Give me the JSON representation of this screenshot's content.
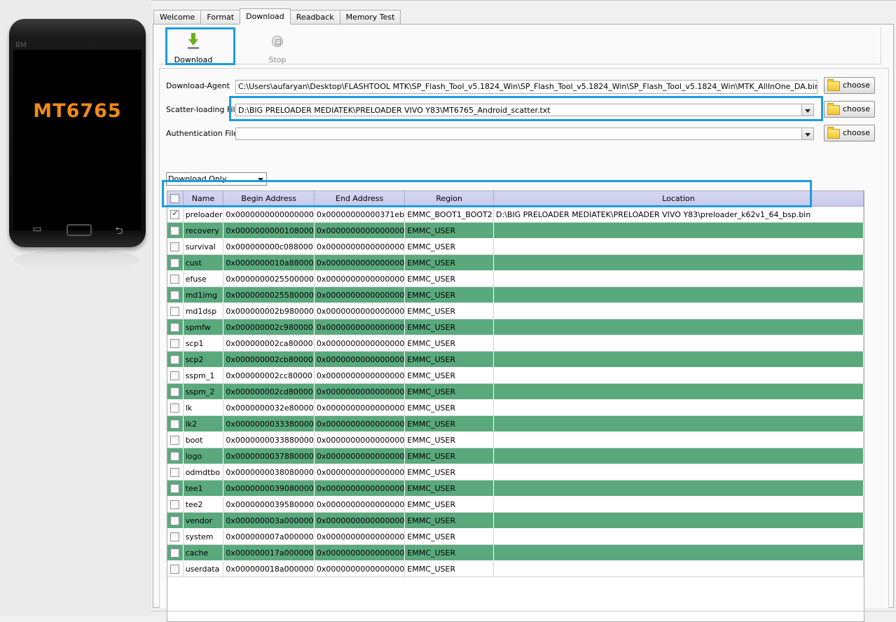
{
  "phone": {
    "brand": "BM",
    "model": "MT6765",
    "menu_key_glyph": "▭",
    "back_key_glyph": "⮌"
  },
  "tabs": [
    {
      "label": "Welcome",
      "active": false
    },
    {
      "label": "Format",
      "active": false
    },
    {
      "label": "Download",
      "active": true
    },
    {
      "label": "Readback",
      "active": false
    },
    {
      "label": "Memory Test",
      "active": false
    }
  ],
  "toolbar": {
    "download_label": "Download",
    "stop_label": "Stop",
    "download_icon": "green-down-arrow-icon",
    "stop_icon": "stop-icon"
  },
  "fields": {
    "download_agent_label": "Download-Agent",
    "download_agent_value": "C:\\Users\\aufaryan\\Desktop\\FLASHTOOL MTK\\SP_Flash_Tool_v5.1824_Win\\SP_Flash_Tool_v5.1824_Win\\SP_Flash_Tool_v5.1824_Win\\MTK_AllInOne_DA.bin",
    "scatter_label": "Scatter-loading File",
    "scatter_value": "D:\\BIG PRELOADER MEDIATEK\\PRELOADER VIVO Y83\\MT6765_Android_scatter.txt",
    "auth_label": "Authentication File",
    "auth_value": "",
    "choose_label": "choose",
    "mode_value": "Download Only"
  },
  "colors": {
    "highlight": "#1b9ce0",
    "row_alt": "#5aa97d",
    "header": "#d0d0f0",
    "accent_text": "#f08a18"
  },
  "table": {
    "columns": [
      "",
      "Name",
      "Begin Address",
      "End Address",
      "Region",
      "Location"
    ],
    "rows": [
      {
        "checked": true,
        "name": "preloader",
        "begin": "0x0000000000000000",
        "end": "0x00000000000371eb",
        "region": "EMMC_BOOT1_BOOT2",
        "location": "D:\\BIG PRELOADER MEDIATEK\\PRELOADER VIVO Y83\\preloader_k62v1_64_bsp.bin"
      },
      {
        "checked": false,
        "name": "recovery",
        "begin": "0x0000000000108000",
        "end": "0x0000000000000000",
        "region": "EMMC_USER",
        "location": ""
      },
      {
        "checked": false,
        "name": "survival",
        "begin": "0x000000000c088000",
        "end": "0x0000000000000000",
        "region": "EMMC_USER",
        "location": ""
      },
      {
        "checked": false,
        "name": "cust",
        "begin": "0x0000000010a88000",
        "end": "0x0000000000000000",
        "region": "EMMC_USER",
        "location": ""
      },
      {
        "checked": false,
        "name": "efuse",
        "begin": "0x0000000025500000",
        "end": "0x0000000000000000",
        "region": "EMMC_USER",
        "location": ""
      },
      {
        "checked": false,
        "name": "md1img",
        "begin": "0x0000000025580000",
        "end": "0x0000000000000000",
        "region": "EMMC_USER",
        "location": ""
      },
      {
        "checked": false,
        "name": "md1dsp",
        "begin": "0x000000002b980000",
        "end": "0x0000000000000000",
        "region": "EMMC_USER",
        "location": ""
      },
      {
        "checked": false,
        "name": "spmfw",
        "begin": "0x000000002c980000",
        "end": "0x0000000000000000",
        "region": "EMMC_USER",
        "location": ""
      },
      {
        "checked": false,
        "name": "scp1",
        "begin": "0x000000002ca80000",
        "end": "0x0000000000000000",
        "region": "EMMC_USER",
        "location": ""
      },
      {
        "checked": false,
        "name": "scp2",
        "begin": "0x000000002cb80000",
        "end": "0x0000000000000000",
        "region": "EMMC_USER",
        "location": ""
      },
      {
        "checked": false,
        "name": "sspm_1",
        "begin": "0x000000002cc80000",
        "end": "0x0000000000000000",
        "region": "EMMC_USER",
        "location": ""
      },
      {
        "checked": false,
        "name": "sspm_2",
        "begin": "0x000000002cd80000",
        "end": "0x0000000000000000",
        "region": "EMMC_USER",
        "location": ""
      },
      {
        "checked": false,
        "name": "lk",
        "begin": "0x0000000032e80000",
        "end": "0x0000000000000000",
        "region": "EMMC_USER",
        "location": ""
      },
      {
        "checked": false,
        "name": "lk2",
        "begin": "0x0000000033380000",
        "end": "0x0000000000000000",
        "region": "EMMC_USER",
        "location": ""
      },
      {
        "checked": false,
        "name": "boot",
        "begin": "0x0000000033880000",
        "end": "0x0000000000000000",
        "region": "EMMC_USER",
        "location": ""
      },
      {
        "checked": false,
        "name": "logo",
        "begin": "0x0000000037880000",
        "end": "0x0000000000000000",
        "region": "EMMC_USER",
        "location": ""
      },
      {
        "checked": false,
        "name": "odmdtbo",
        "begin": "0x0000000038080000",
        "end": "0x0000000000000000",
        "region": "EMMC_USER",
        "location": ""
      },
      {
        "checked": false,
        "name": "tee1",
        "begin": "0x0000000039080000",
        "end": "0x0000000000000000",
        "region": "EMMC_USER",
        "location": ""
      },
      {
        "checked": false,
        "name": "tee2",
        "begin": "0x0000000039580000",
        "end": "0x0000000000000000",
        "region": "EMMC_USER",
        "location": ""
      },
      {
        "checked": false,
        "name": "vendor",
        "begin": "0x000000003a000000",
        "end": "0x0000000000000000",
        "region": "EMMC_USER",
        "location": ""
      },
      {
        "checked": false,
        "name": "system",
        "begin": "0x000000007a000000",
        "end": "0x0000000000000000",
        "region": "EMMC_USER",
        "location": ""
      },
      {
        "checked": false,
        "name": "cache",
        "begin": "0x000000017a000000",
        "end": "0x0000000000000000",
        "region": "EMMC_USER",
        "location": ""
      },
      {
        "checked": false,
        "name": "userdata",
        "begin": "0x000000018a000000",
        "end": "0x0000000000000000",
        "region": "EMMC_USER",
        "location": ""
      }
    ]
  }
}
